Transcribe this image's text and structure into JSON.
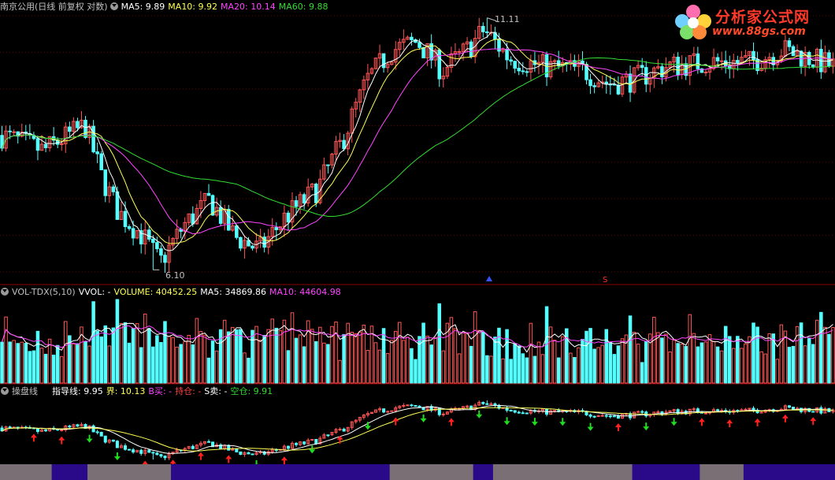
{
  "main": {
    "title": "南京公用(日线 前复权 对数)",
    "ma_items": [
      {
        "label": "MA5: 9.89",
        "color": "#ffffff"
      },
      {
        "label": "MA10: 9.92",
        "color": "#ffff55"
      },
      {
        "label": "MA20: 10.14",
        "color": "#ff44ff"
      },
      {
        "label": "MA60: 9.88",
        "color": "#33dd33"
      }
    ],
    "high_label": "11.11",
    "low_label": "6.10",
    "signal_s": "S"
  },
  "volume": {
    "title": "VOL-TDX(5,10)",
    "items": [
      {
        "label": "VVOL: -",
        "color": "#ffffff"
      },
      {
        "label": "VOLUME: 40452.25",
        "color": "#ffff55"
      },
      {
        "label": "MA5: 34869.86",
        "color": "#ffffff"
      },
      {
        "label": "MA10: 44604.98",
        "color": "#ff44ff"
      }
    ]
  },
  "indicator": {
    "title": "操盘线",
    "items": [
      {
        "label": "指导线: 9.95",
        "color": "#ffffff"
      },
      {
        "label": "界: 10.13",
        "color": "#ffff55"
      },
      {
        "label": "B买: -",
        "color": "#ff44ff"
      },
      {
        "label": "持仓: -",
        "color": "#ff4444"
      },
      {
        "label": "S卖: -",
        "color": "#ffffff"
      },
      {
        "label": "空仓: 9.91",
        "color": "#33dd33"
      }
    ]
  },
  "logo": {
    "title": "分析家公式网",
    "url": "www.88gs.com"
  },
  "chart_data": {
    "type": "candlestick",
    "scale": "log",
    "high": 11.11,
    "low": 6.1,
    "price_anchor_points": [
      {
        "t": 0,
        "v": 8.4
      },
      {
        "t": 0.05,
        "v": 8.1
      },
      {
        "t": 0.1,
        "v": 8.6
      },
      {
        "t": 0.12,
        "v": 7.6
      },
      {
        "t": 0.14,
        "v": 7.0
      },
      {
        "t": 0.17,
        "v": 6.6
      },
      {
        "t": 0.19,
        "v": 6.2
      },
      {
        "t": 0.22,
        "v": 6.8
      },
      {
        "t": 0.25,
        "v": 7.2
      },
      {
        "t": 0.28,
        "v": 6.6
      },
      {
        "t": 0.31,
        "v": 6.4
      },
      {
        "t": 0.34,
        "v": 6.9
      },
      {
        "t": 0.38,
        "v": 7.4
      },
      {
        "t": 0.41,
        "v": 8.3
      },
      {
        "t": 0.44,
        "v": 9.6
      },
      {
        "t": 0.47,
        "v": 10.3
      },
      {
        "t": 0.5,
        "v": 10.5
      },
      {
        "t": 0.53,
        "v": 9.8
      },
      {
        "t": 0.56,
        "v": 10.3
      },
      {
        "t": 0.58,
        "v": 10.8
      },
      {
        "t": 0.61,
        "v": 10.1
      },
      {
        "t": 0.65,
        "v": 9.9
      },
      {
        "t": 0.7,
        "v": 9.8
      },
      {
        "t": 0.73,
        "v": 9.5
      },
      {
        "t": 0.76,
        "v": 9.6
      },
      {
        "t": 0.8,
        "v": 9.9
      },
      {
        "t": 0.85,
        "v": 10.0
      },
      {
        "t": 0.9,
        "v": 10.0
      },
      {
        "t": 0.94,
        "v": 10.3
      },
      {
        "t": 0.97,
        "v": 10.1
      },
      {
        "t": 1,
        "v": 9.9
      }
    ],
    "signal_colors": {
      "up": "#ff5555",
      "down": "#55ffff",
      "ma5": "#ffffff",
      "ma10": "#ffff55",
      "ma20": "#ff44ff",
      "ma60": "#33dd33",
      "buy": "#ff2020",
      "sell": "#20dd20"
    }
  }
}
